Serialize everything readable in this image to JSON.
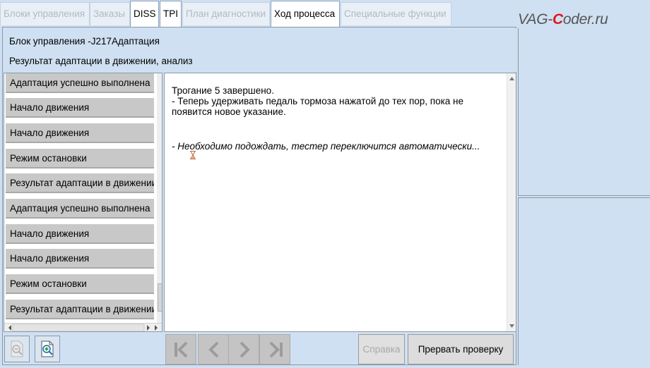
{
  "tabs": [
    {
      "label": "Блоки управления",
      "active": false
    },
    {
      "label": "Заказы",
      "active": false
    },
    {
      "label": "DISS",
      "active": true
    },
    {
      "label": "TPI",
      "active": true
    },
    {
      "label": "План диагностики",
      "active": false
    },
    {
      "label": "Ход процесса",
      "active": true
    },
    {
      "label": "Специальные функции",
      "active": false
    }
  ],
  "logo": {
    "prefix": "VAG-",
    "highlight": "C",
    "suffix": "oder.ru"
  },
  "header": {
    "line1": "Блок управления -J217Адаптация",
    "line2": "Результат адаптации в движении, анализ"
  },
  "list": [
    "Адаптация успешно выполнена",
    "Начало движения",
    "Начало движения",
    "Режим остановки",
    "Результат адаптации в движении",
    "Адаптация успешно выполнена",
    "Начало движения",
    "Начало движения",
    "Режим остановки",
    "Результат адаптации в движении"
  ],
  "content": {
    "line1": "Трогание 5  завершено.",
    "line2": "- Теперь удерживать педаль тормоза нажатой до тех пор, пока не",
    "line3": "появится новое указание.",
    "wait": "- Необходимо подождать, тестер переключится автоматически..."
  },
  "buttons": {
    "help": "Справка",
    "abort": "Прервать проверку"
  },
  "icons": {
    "zoom_out": "zoom-out-icon",
    "zoom_in": "zoom-in-icon",
    "hourglass": "hourglass-icon"
  },
  "colors": {
    "background": "#cfe0f2",
    "list_item": "#c8c8c8",
    "logo_accent": "#e0161b"
  }
}
